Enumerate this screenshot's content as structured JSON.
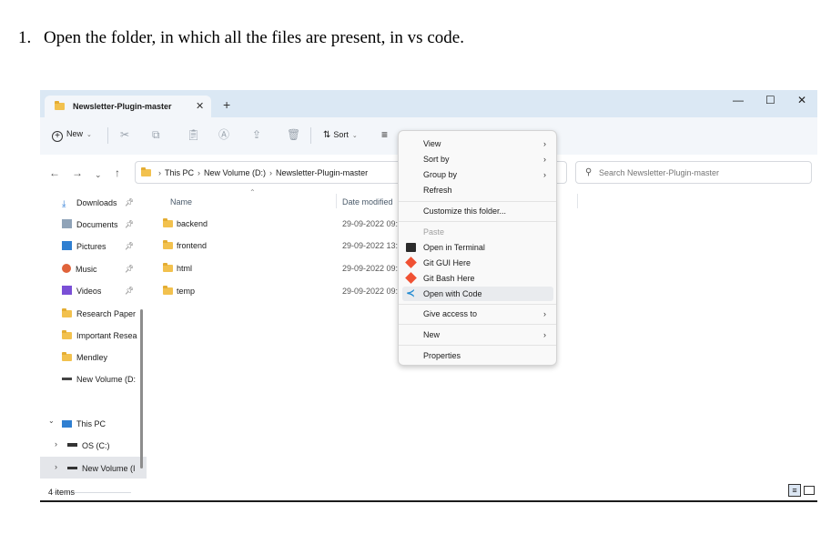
{
  "document": {
    "step_number": "1.",
    "step_text": "Open the folder, in which all the files are present, in vs code."
  },
  "tab": {
    "title": "Newsletter-Plugin-master",
    "close": "✕",
    "new_tab": "+"
  },
  "window_controls": {
    "minimize": "—",
    "maximize": "☐",
    "close": "✕"
  },
  "toolbar": {
    "new_label": "New",
    "sort_label": "Sort"
  },
  "address": {
    "crumbs": [
      "This PC",
      "New Volume (D:)",
      "Newsletter-Plugin-master"
    ]
  },
  "search": {
    "placeholder": "Search Newsletter-Plugin-master"
  },
  "sidebar": {
    "quick_access": [
      {
        "label": "Downloads",
        "icon": "download-icon",
        "pinned": true
      },
      {
        "label": "Documents",
        "icon": "documents-icon",
        "pinned": true
      },
      {
        "label": "Pictures",
        "icon": "pictures-icon",
        "pinned": true
      },
      {
        "label": "Music",
        "icon": "music-icon",
        "pinned": true
      },
      {
        "label": "Videos",
        "icon": "videos-icon",
        "pinned": true
      },
      {
        "label": "Research Paper",
        "icon": "folder-icon"
      },
      {
        "label": "Important Resea",
        "icon": "folder-icon"
      },
      {
        "label": "Mendley",
        "icon": "folder-icon"
      },
      {
        "label": "New Volume (D:",
        "icon": "drive-icon"
      }
    ],
    "this_pc": {
      "label": "This PC",
      "children": [
        "OS (C:)",
        "New Volume (I"
      ]
    }
  },
  "columns": {
    "name": "Name",
    "date_modified": "Date modified"
  },
  "files": [
    {
      "name": "backend",
      "date": "29-09-2022 09:"
    },
    {
      "name": "frontend",
      "date": "29-09-2022 13:"
    },
    {
      "name": "html",
      "date": "29-09-2022 09:"
    },
    {
      "name": "temp",
      "date": "29-09-2022 09:"
    }
  ],
  "status": {
    "item_count": "4 items"
  },
  "context_menu": {
    "view": "View",
    "sort_by": "Sort by",
    "group_by": "Group by",
    "refresh": "Refresh",
    "customize": "Customize this folder...",
    "paste": "Paste",
    "open_terminal": "Open in Terminal",
    "git_gui": "Git GUI Here",
    "git_bash": "Git Bash Here",
    "open_with_code": "Open with Code",
    "give_access": "Give access to",
    "new": "New",
    "properties": "Properties"
  },
  "colors": {
    "titlebar": "#dbe8f4",
    "toolbar": "#f3f6fa",
    "folder": "#f2c14e",
    "vscode_blue": "#1f8ad2",
    "git_orange": "#f05133"
  }
}
